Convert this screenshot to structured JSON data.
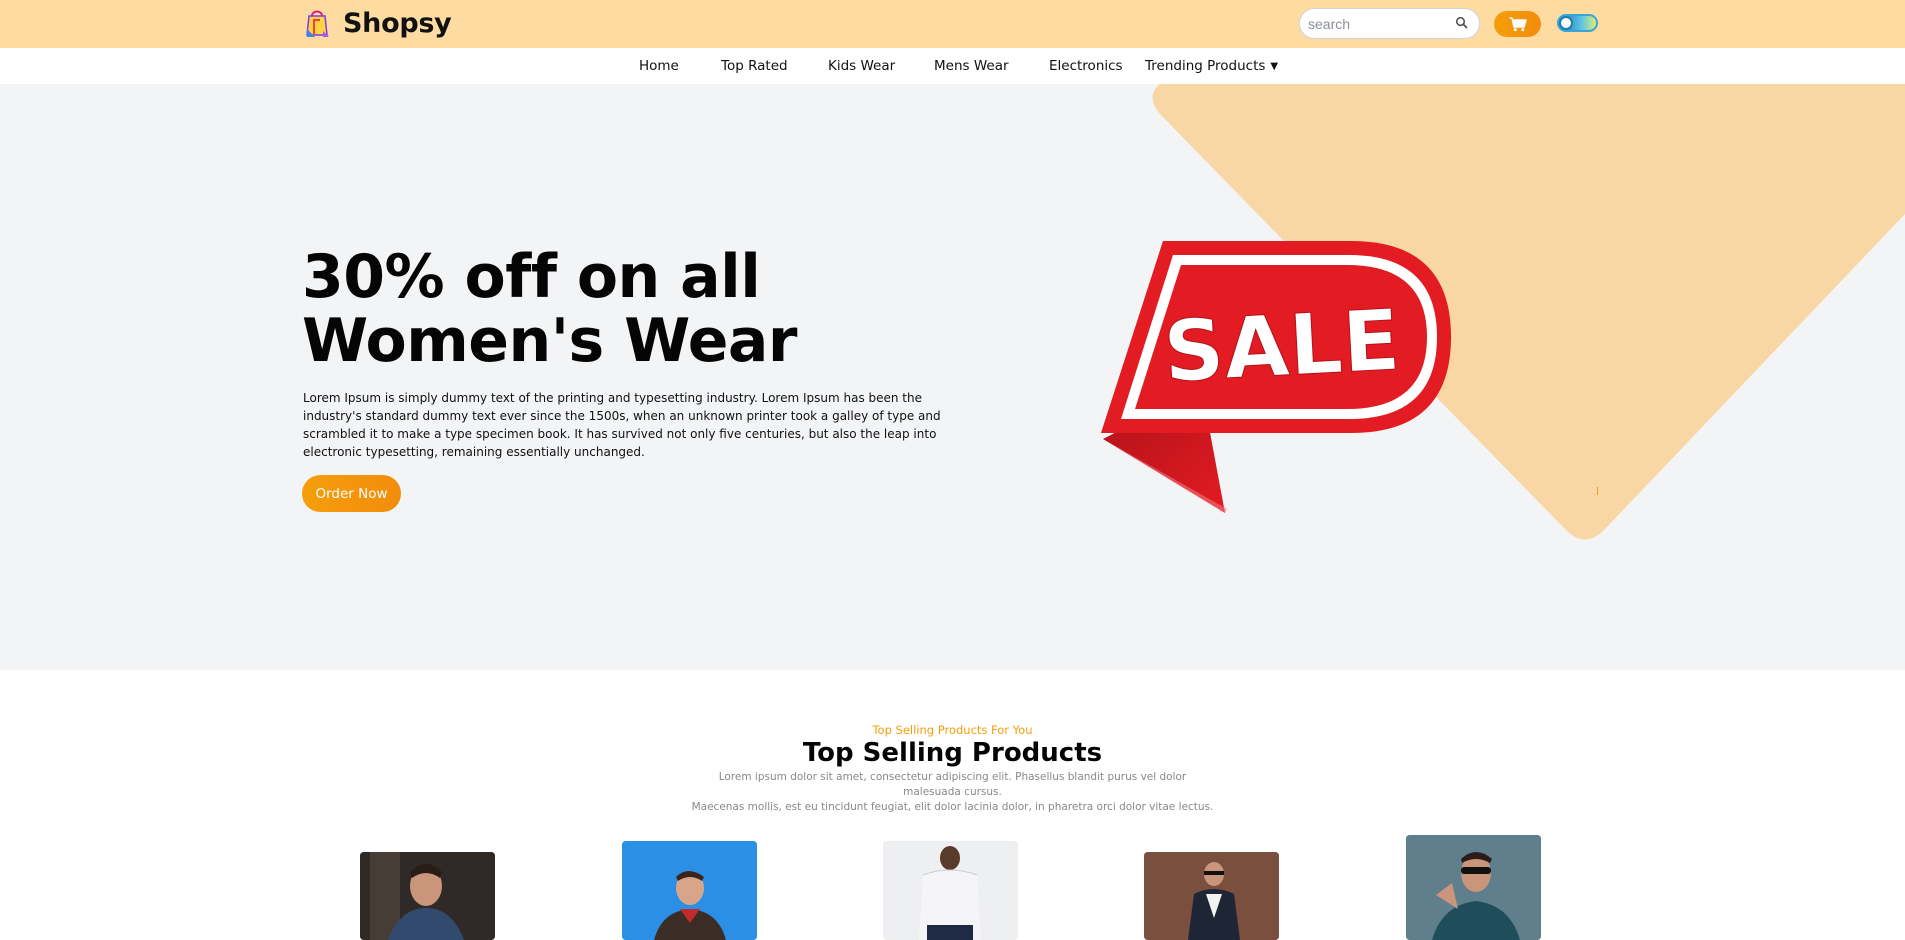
{
  "header": {
    "brand": "Shopsy",
    "search_placeholder": "search"
  },
  "nav": {
    "items": [
      "Home",
      "Top Rated",
      "Kids Wear",
      "Mens Wear",
      "Electronics"
    ],
    "dropdown_label": "Trending Products"
  },
  "hero": {
    "title_line1": "30% off on all",
    "title_line2": "Women's Wear",
    "description": "Lorem Ipsum is simply dummy text of the printing and typesetting industry. Lorem Ipsum has been the industry's standard dummy text ever since the 1500s, when an unknown printer took a galley of type and scrambled it to make a type specimen book. It has survived not only five centuries, but also the leap into electronic typesetting, remaining essentially unchanged.",
    "cta_label": "Order Now",
    "badge_text": "SALE"
  },
  "products": {
    "subtitle": "Top Selling Products For You",
    "title": "Top Selling Products",
    "desc_line1": "Lorem ipsum dolor sit amet, consectetur adipiscing elit. Phasellus blandit purus vel dolor malesuada cursus.",
    "desc_line2": "Maecenas mollis, est eu tincidunt feugiat, elit dolor lacinia dolor, in pharetra orci dolor vitae lectus."
  },
  "colors": {
    "header_bg": "#fedba1",
    "accent": "#f59e0b",
    "hero_bg": "#f3f4f6",
    "hero_shape": "#f8d7a4",
    "sale_red": "#e31b23"
  },
  "icons": [
    "shopping-bag-logo-icon",
    "search-icon",
    "cart-icon",
    "theme-toggle-icon",
    "caret-down-icon"
  ]
}
